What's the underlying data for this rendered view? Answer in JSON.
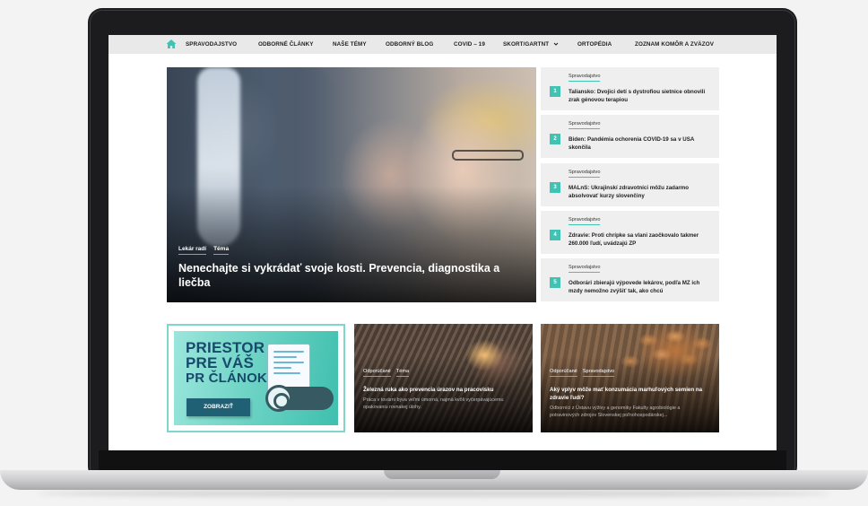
{
  "nav": {
    "items": [
      "SPRAVODAJSTVO",
      "ODBORNÉ ČLÁNKY",
      "NAŠE TÉMY",
      "ODBORNÝ BLOG",
      "COVID – 19",
      "SKORT/GARTNT",
      "ORTOPÉDIA",
      "ZOZNAM KOMÔR A ZVÄZOV"
    ]
  },
  "hero": {
    "tags": [
      "Lekár radí",
      "Téma"
    ],
    "title": "Nenechajte si vykrádať svoje kosti. Prevencia, diagnostika a liečba"
  },
  "side": {
    "items": [
      {
        "num": "1",
        "category": "Spravodajstvo",
        "title": "Taliansko: Dvojici detí s dystrofiou sietnice obnovili zrak génovou terapiou"
      },
      {
        "num": "2",
        "category": "Spravodajstvo",
        "title": "Biden: Pandémia ochorenia COVID-19 sa v USA skončila"
      },
      {
        "num": "3",
        "category": "Spravodajstvo",
        "title": "MALnS: Ukrajinskí zdravotníci môžu zadarmo absolvovať kurzy slovenčiny"
      },
      {
        "num": "4",
        "category": "Spravodajstvo",
        "title": "Zdravie: Proti chrípke sa vlani zaočkovalo takmer 260.000 ľudí, uvádzajú ZP"
      },
      {
        "num": "5",
        "category": "Spravodajstvo",
        "title": "Odborári zbierajú výpovede lekárov, podľa MZ ich mzdy nemožno zvýšiť tak, ako chcú"
      }
    ]
  },
  "ad": {
    "line1": "PRIESTOR",
    "line2": "PRE VÁŠ",
    "line3": "PR ČLÁNOK",
    "button": "ZOBRAZIŤ"
  },
  "cards": [
    {
      "tags": [
        "Odporúčané",
        "Téma"
      ],
      "title": "Železná ruka ako prevencia úrazov na pracovisku",
      "desc": "Práca v továrni býva veľmi úmorná, najmä kvôli vyčerpávajúcemu opakovaniu rovnakej úlohy."
    },
    {
      "tags": [
        "Odporúčané",
        "Spravodajstvo"
      ],
      "title": "Aký vplyv môže mať konzumácia marhuľových semien na zdravie ľudí?",
      "desc": "Odborníci z Ústavu výživy a genomiky Fakulty agrobiológie a potravinových zdrojov Slovenskej poľnohospodárskej..."
    }
  ],
  "colors": {
    "accent": "#41c2b3",
    "nav_bg": "#e9e9e9",
    "ad_button": "#1f6075"
  },
  "icons": {
    "home": "home-icon"
  }
}
